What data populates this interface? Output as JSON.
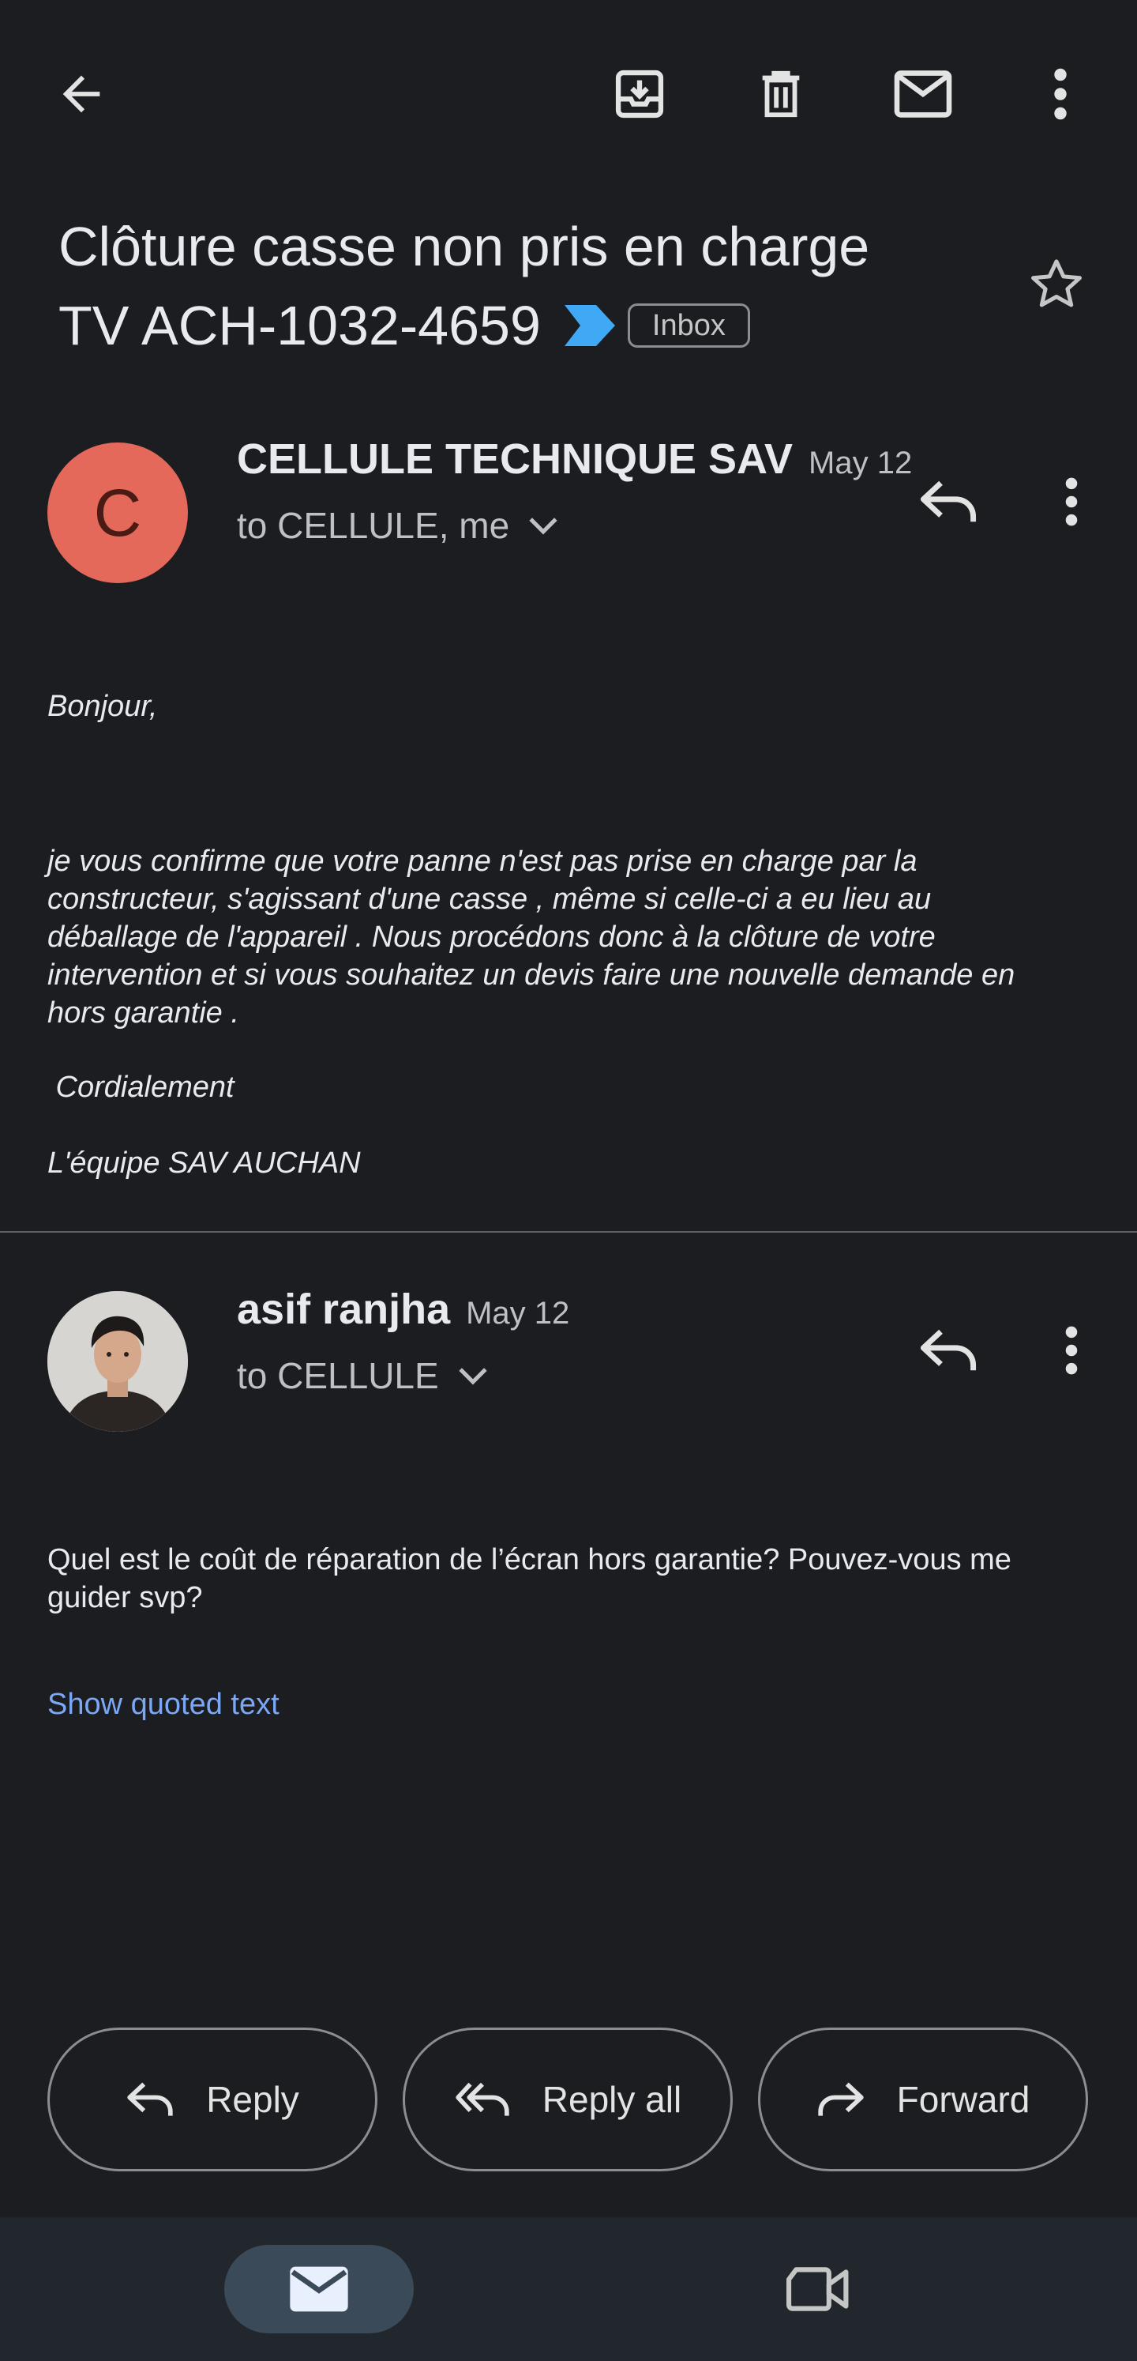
{
  "header": {
    "back_icon": "arrow-back-icon",
    "archive_icon": "archive-icon",
    "delete_icon": "delete-icon",
    "mark_unread_icon": "mail-icon",
    "more_icon": "more-vertical-icon"
  },
  "subject": {
    "line1": "Clôture casse non pris en charge",
    "line2": "TV ACH-1032-4659",
    "label": "Inbox",
    "important_color": "#3fa9f5"
  },
  "messages": [
    {
      "avatar_letter": "C",
      "avatar_color": "#e5695a",
      "sender": "CELLULE TECHNIQUE SAV",
      "date": "May 12",
      "recipients": "to CELLULE, me",
      "body": {
        "greeting": "Bonjour,",
        "lines": [
          "je vous confirme que votre panne  n'est pas prise en charge par la",
          "constructeur, s'agissant d'une casse , même si celle-ci a eu lieu au",
          "déballage de l'appareil  . Nous procédons donc à la clôture de votre",
          "intervention et si vous souhaitez un devis faire une nouvelle demande en",
          "hors garantie ."
        ],
        "closing": " Cordialement",
        "signature": "L'équipe SAV AUCHAN"
      }
    },
    {
      "avatar": "profile-photo",
      "sender": "asif ranjha",
      "date": "May 12",
      "recipients": "to CELLULE",
      "body": {
        "lines": [
          "Quel est le coût de réparation de l’écran hors garantie? Pouvez-vous me",
          "guider svp?"
        ]
      },
      "show_quoted": "Show quoted text"
    }
  ],
  "actions": {
    "reply": "Reply",
    "reply_all": "Reply all",
    "forward": "Forward"
  },
  "bottom_nav": {
    "mail_icon": "mail-icon",
    "meet_icon": "video-camera-icon",
    "active_color": "#3b4a58"
  }
}
